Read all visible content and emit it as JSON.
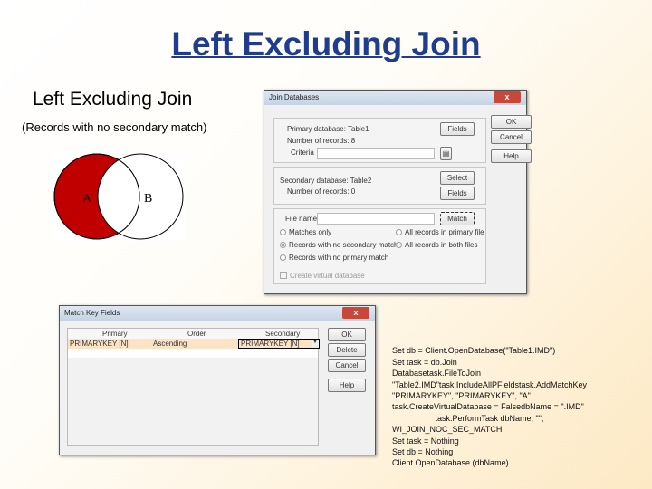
{
  "slide": {
    "title": "Left Excluding Join",
    "subtitle": "Left Excluding Join",
    "note": "(Records with no secondary match)"
  },
  "venn": {
    "left_label": "A",
    "right_label": "B",
    "fill_color": "#c00000"
  },
  "join_dialog": {
    "title": "Join Databases",
    "close": "x",
    "primary_db": "Primary database: Table1",
    "primary_records": "Number of records: 8",
    "criteria_label": "Criteria",
    "secondary_db": "Secondary database: Table2",
    "secondary_records": "Number of records: 0",
    "file_name_label": "File name",
    "file_name_value": "",
    "buttons": {
      "fields1": "Fields",
      "select": "Select",
      "fields2": "Fields",
      "match": "Match",
      "ok": "OK",
      "cancel": "Cancel",
      "help": "Help"
    },
    "options": [
      {
        "label": "Matches only",
        "selected": false
      },
      {
        "label": "Records with no secondary match",
        "selected": true
      },
      {
        "label": "Records with no primary match",
        "selected": false
      },
      {
        "label": "All records in primary file",
        "selected": false
      },
      {
        "label": "All records in both files",
        "selected": false
      }
    ],
    "checkbox": "Create virtual database"
  },
  "match_dialog": {
    "title": "Match Key Fields",
    "close": "x",
    "headers": [
      "Primary",
      "Order",
      "Secondary"
    ],
    "row": {
      "primary": "PRIMARYKEY [N]",
      "order": "Ascending",
      "secondary": "PRIMARYKEY [N]"
    },
    "buttons": {
      "ok": "OK",
      "delete": "Delete",
      "cancel": "Cancel",
      "help": "Help"
    }
  },
  "code": [
    "Set db = Client.OpenDatabase(\"Table1.IMD\")",
    "Set task = db.Join",
    "Databasetask.FileToJoin",
    "\"Table2.IMD\"task.IncludeAllPFieldstask.AddMatchKey",
    "\"PRIMARYKEY\", \"PRIMARYKEY\", \"A\"",
    "task.CreateVirtualDatabase = FalsedbName = \".IMD\"",
    "                   task.PerformTask dbName, \"\",",
    "WI_JOIN_NOC_SEC_MATCH",
    "Set task = Nothing",
    "Set db = Nothing",
    "Client.OpenDatabase (dbName)"
  ]
}
